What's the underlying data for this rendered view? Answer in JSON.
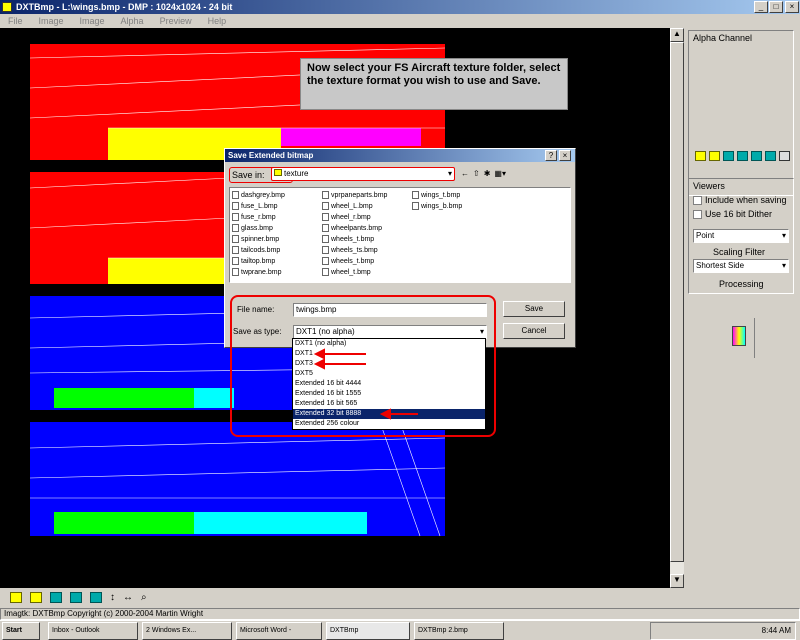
{
  "window": {
    "title": "DXTBmp - L:\\wings.bmp - DMP : 1024x1024 - 24 bit",
    "min": "_",
    "max": "□",
    "close": "×"
  },
  "menu": [
    "File",
    "Image",
    "Image",
    "Alpha",
    "Preview",
    "Help"
  ],
  "annotation": "Now select your FS Aircraft texture folder, select the texture format you wish to use and Save.",
  "dialog": {
    "title": "Save Extended bitmap",
    "help": "?",
    "close": "×",
    "save_in_label": "Save in:",
    "save_in_value": "texture",
    "files_col1": [
      "dashgrey.bmp",
      "fuse_L.bmp",
      "fuse_r.bmp",
      "glass.bmp",
      "spinner.bmp",
      "tailcods.bmp",
      "tailtop.bmp",
      "twprane.bmp"
    ],
    "files_col2": [
      "vprpaneparts.bmp",
      "wheel_L.bmp",
      "wheel_r.bmp",
      "wheelpants.bmp",
      "wheels_t.bmp",
      "wheels_ts.bmp",
      "wheels_t.bmp",
      "wheel_t.bmp"
    ],
    "files_col3": [
      "wings_t.bmp",
      "wings_b.bmp"
    ],
    "filename_label": "File name:",
    "filename_value": "twings.bmp",
    "filetype_label": "Save as type:",
    "filetype_value": "DXT1 (no alpha)",
    "save_button": "Save",
    "cancel_button": "Cancel",
    "options": [
      "DXT1 (no alpha)",
      "DXT1",
      "DXT3",
      "DXT5",
      "Extended 16 bit 4444",
      "Extended 16 bit 1555",
      "Extended 16 bit 565",
      "Extended 32 bit 8888",
      "Extended 256 colour"
    ],
    "selected_index": 7
  },
  "right_panel": {
    "alpha_title": "Alpha Channel",
    "viewer_title": "Viewers",
    "check1": "Include when saving",
    "check2": "Use 16 bit Dither",
    "select1": "Point",
    "scaling_label": "Scaling Filter",
    "select2": "Shortest Side",
    "processing": "Processing"
  },
  "status": "Imagtk: DXTBmp Copyright (c) 2000-2004 Martin Wright",
  "taskbar": {
    "start": "Start",
    "tasks": [
      "Inbox - Outlook",
      "2 Windows Ex...",
      "Microsoft Word -",
      "DXTBmp",
      "DXTBmp 2.bmp"
    ],
    "clock": "8:44 AM"
  },
  "colors": {
    "red": "#ff0000",
    "blue": "#0000ff",
    "yellow": "#ffff00",
    "magenta": "#ff00ff",
    "green": "#00ff00",
    "cyan": "#00ffff",
    "canvas_bg": "#000000"
  }
}
